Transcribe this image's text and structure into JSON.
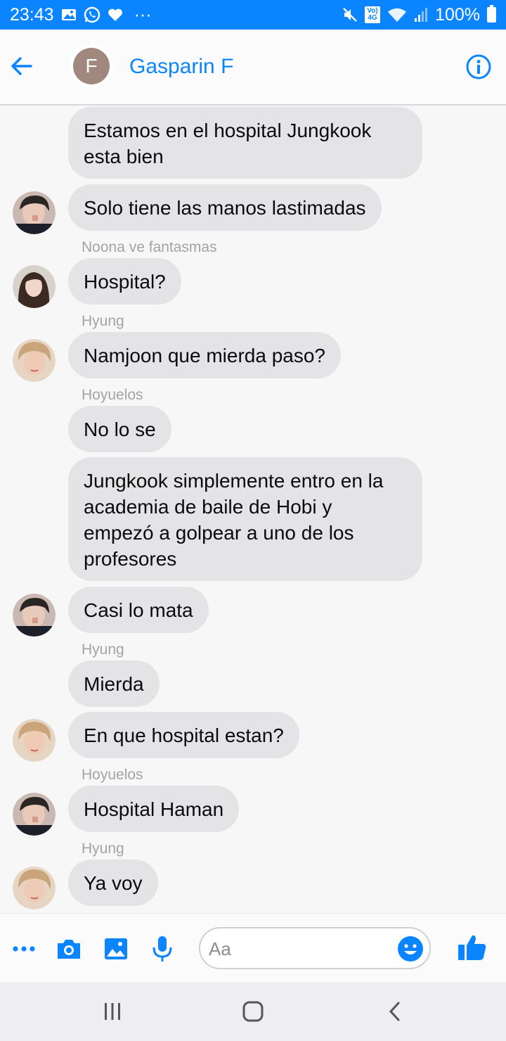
{
  "status_bar": {
    "time": "23:43",
    "battery": "100%",
    "network_badge_top": "Vo)",
    "network_badge_bottom": "4G",
    "overflow": "···",
    "left_icons": [
      "gallery-icon",
      "whatsapp-icon",
      "heart-icon"
    ],
    "right_icons": [
      "mute-icon",
      "volte-4g-icon",
      "wifi-icon",
      "signal-icon",
      "battery-icon"
    ],
    "bg_color": "#0a84ff"
  },
  "header": {
    "contact_name": "Gasparin F",
    "avatar_initial": "F",
    "avatar_color": "#a1887f",
    "accent_color": "#0a84ff"
  },
  "messages": [
    {
      "sender": "",
      "text": "Estamos en el hospital Jungkook esta bien",
      "avatar": ""
    },
    {
      "sender": "",
      "text": "Solo tiene las manos lastimadas",
      "avatar": "man-dark-hair"
    },
    {
      "sender": "Noona ve fantasmas",
      "text": "Hospital?",
      "avatar": "woman-long-hair"
    },
    {
      "sender": "Hyung",
      "text": "Namjoon que mierda paso?",
      "avatar": "man-blond-hair"
    },
    {
      "sender": "Hoyuelos",
      "text": "No lo se",
      "avatar": ""
    },
    {
      "sender": "",
      "text": "Jungkook simplemente entro en la academia de baile de Hobi y empezó a golpear a uno de los profesores",
      "avatar": ""
    },
    {
      "sender": "",
      "text": "Casi lo mata",
      "avatar": "man-dark-hair"
    },
    {
      "sender": "Hyung",
      "text": "Mierda",
      "avatar": ""
    },
    {
      "sender": "",
      "text": "En que hospital estan?",
      "avatar": "man-blond-hair"
    },
    {
      "sender": "Hoyuelos",
      "text": "Hospital Haman",
      "avatar": "man-dark-hair"
    },
    {
      "sender": "Hyung",
      "text": "Ya voy",
      "avatar": "man-blond-hair"
    }
  ],
  "composer": {
    "placeholder": "Aa",
    "icons": [
      "more-icon",
      "camera-icon",
      "gallery-icon",
      "microphone-icon",
      "emoji-icon",
      "like-icon"
    ]
  },
  "nav_bar": {
    "icons": [
      "recent-apps-icon",
      "home-icon",
      "back-icon"
    ]
  }
}
